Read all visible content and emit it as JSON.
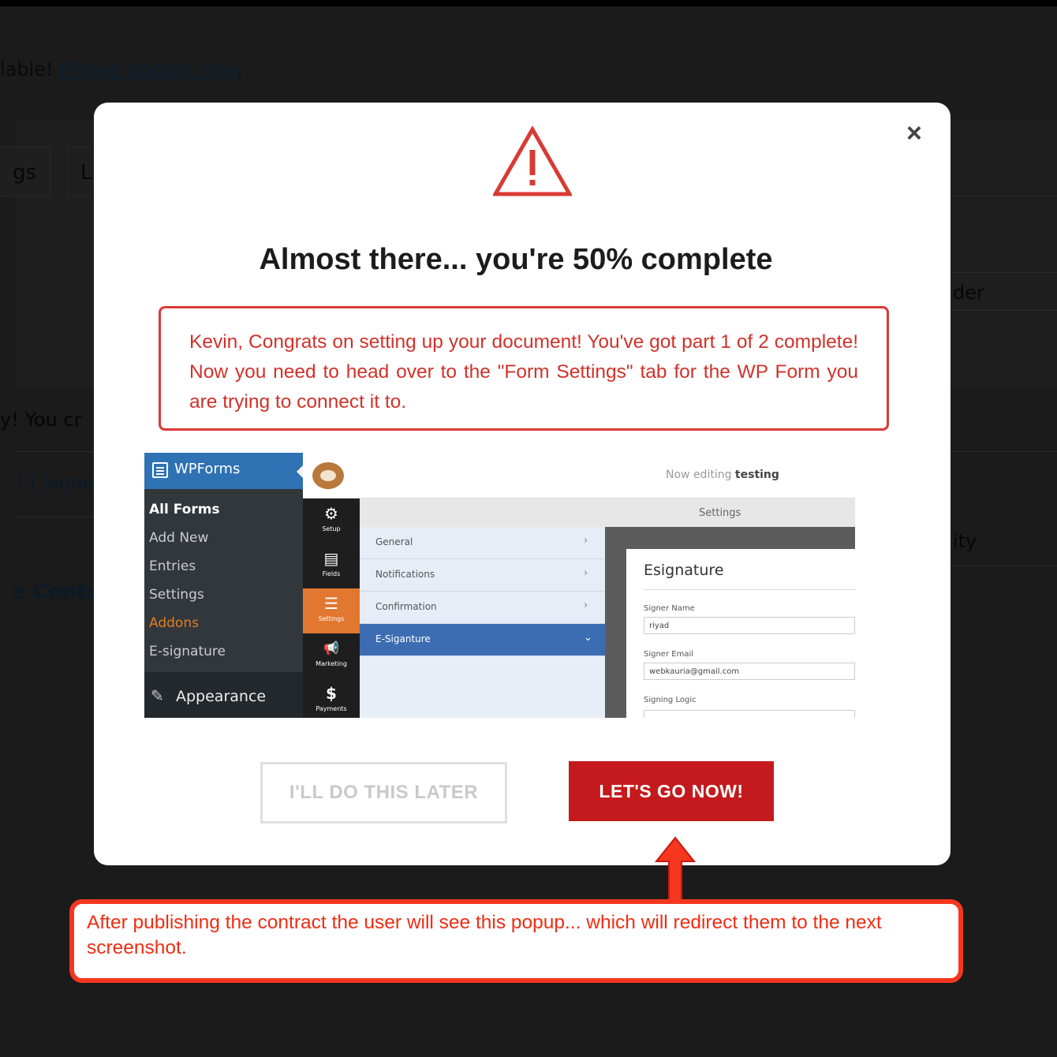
{
  "background": {
    "notice_prefix": "lable! ",
    "notice_link": "Please update now",
    "notice_suffix": ".",
    "tab1": "gs",
    "tab2": "L",
    "fragment_right1": "der",
    "fragment_left1": "y! You cr",
    "fragment_left2": ") | Signe",
    "fragment_right2": "ity",
    "fragment_left3": "e Contra"
  },
  "modal": {
    "close_label": "×",
    "title": "Almost there... you're 50% complete",
    "alert_text": "Kevin, Congrats on setting up your document! You've got part 1 of 2 complete! Now you need to head over to the \"Form Settings\" tab for the WP Form you are trying to connect it to.",
    "later_button": "I'LL DO THIS LATER",
    "go_button": "LET'S GO NOW!",
    "warning_color": "#d93a34",
    "button_color": "#c41a1d"
  },
  "screenshot": {
    "menu_title": "WPForms",
    "menu_items": [
      "All Forms",
      "Add New",
      "Entries",
      "Settings",
      "Addons",
      "E-signature"
    ],
    "appearance": "Appearance",
    "editing_prefix": "Now editing",
    "editing_name": "testing",
    "sidebar": [
      {
        "glyph": "⚙",
        "label": "Setup"
      },
      {
        "glyph": "▤",
        "label": "Fields"
      },
      {
        "glyph": "☰",
        "label": "Settings"
      },
      {
        "glyph": "📢",
        "label": "Marketing"
      },
      {
        "glyph": "$",
        "label": "Payments"
      }
    ],
    "settings_header": "Settings",
    "panels": [
      {
        "label": "General",
        "chevron": "›"
      },
      {
        "label": "Notifications",
        "chevron": "›"
      },
      {
        "label": "Confirmation",
        "chevron": "›"
      },
      {
        "label": "E-Siganture",
        "chevron": "⌄"
      }
    ],
    "card_title": "Esignature",
    "signer_name_label": "Signer Name",
    "signer_name_value": "riyad",
    "signer_email_label": "Signer Email",
    "signer_email_value": "webkauria@gmail.com",
    "signing_logic_label": "Signing Logic"
  },
  "annotation": {
    "text": "After publishing the contract the user will see this popup... which will redirect them to the next screenshot.",
    "color": "#f6371f"
  }
}
